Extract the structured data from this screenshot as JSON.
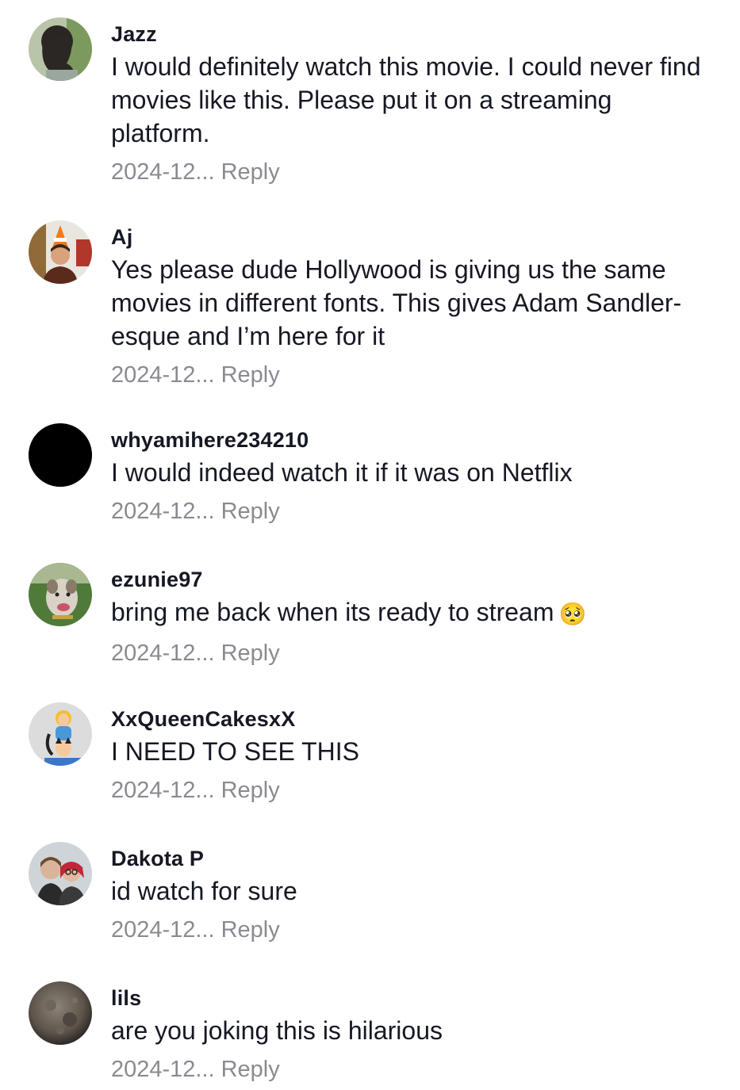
{
  "comments": [
    {
      "username": "Jazz",
      "text": "I would definitely watch this movie. I could never find movies like this. Please put it on a streaming platform.",
      "date": "2024-12...",
      "reply": "Reply"
    },
    {
      "username": "Aj",
      "text": "Yes please dude Hollywood is giving us the same movies in different fonts. This gives Adam Sandler-esque and I’m here for it",
      "date": "2024-12...",
      "reply": "Reply"
    },
    {
      "username": "whyamihere234210",
      "text": "I would indeed watch it if it was on Netflix",
      "date": "2024-12...",
      "reply": "Reply"
    },
    {
      "username": "ezunie97",
      "text": "bring me back when its ready to stream",
      "emoji": "🥺",
      "date": "2024-12...",
      "reply": "Reply"
    },
    {
      "username": "XxQueenCakesxX",
      "text": "I NEED TO SEE THIS",
      "date": "2024-12...",
      "reply": "Reply"
    },
    {
      "username": "Dakota P",
      "text": "id watch for sure",
      "date": "2024-12...",
      "reply": "Reply"
    },
    {
      "username": "lils",
      "text": "are you joking this is hilarious",
      "date": "2024-12...",
      "reply": "Reply"
    }
  ]
}
